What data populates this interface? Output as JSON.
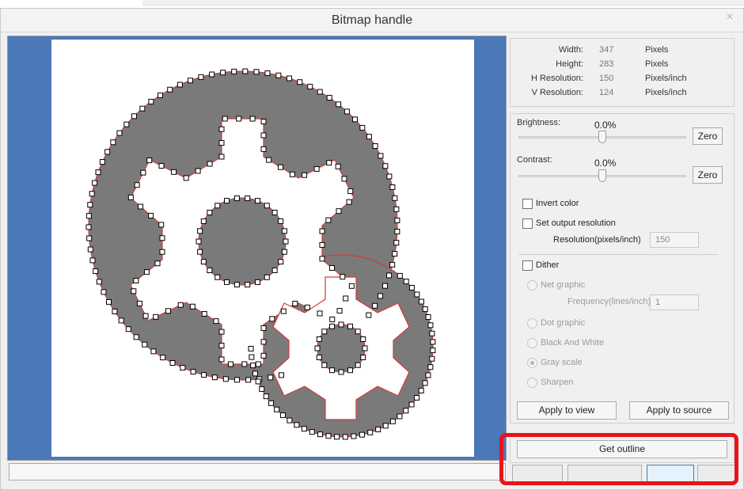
{
  "window": {
    "title": "Bitmap handle",
    "close_glyph": "×"
  },
  "info": {
    "rows": [
      {
        "label": "Width:",
        "value": "347",
        "unit": "Pixels"
      },
      {
        "label": "Height:",
        "value": "283",
        "unit": "Pixels"
      },
      {
        "label": "H Resolution:",
        "value": "150",
        "unit": "Pixels/inch"
      },
      {
        "label": "V Resolution:",
        "value": "124",
        "unit": "Pixels/inch"
      }
    ]
  },
  "brightness": {
    "label": "Brightness:",
    "value": "0.0%",
    "level": 0.5,
    "zero_label": "Zero"
  },
  "contrast": {
    "label": "Contrast:",
    "value": "0.0%",
    "level": 0.5,
    "zero_label": "Zero"
  },
  "options": {
    "invert_color": "Invert color",
    "set_output_resolution": "Set output resolution",
    "resolution_label": "Resolution(pixels/inch)",
    "resolution_value": "150",
    "dither": "Dither",
    "net_graphic": "Net graphic",
    "frequency_label": "Frequency(lines/inch):",
    "frequency_value": "1",
    "dot_graphic": "Dot graphic",
    "black_and_white": "Black And White",
    "gray_scale": "Gray scale",
    "sharpen": "Sharpen"
  },
  "buttons": {
    "apply_to_view": "Apply to view",
    "apply_to_source": "Apply to source",
    "get_outline": "Get outline"
  },
  "colors": {
    "accent_highlight": "#e8141b",
    "view_background": "#4a78b8",
    "gear_fill": "#7a7a7a",
    "outline": "#d33a3a"
  },
  "icons": {
    "close": "close-icon"
  }
}
